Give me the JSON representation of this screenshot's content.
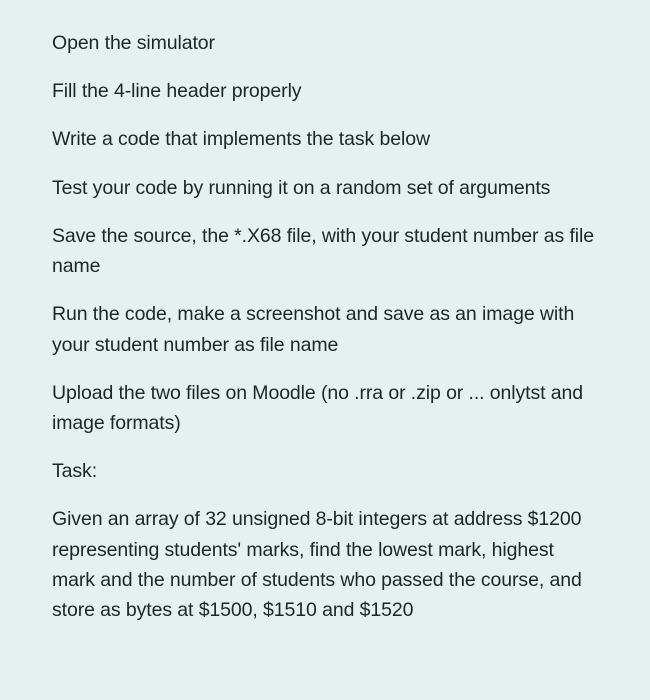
{
  "paragraphs": [
    "Open the simulator",
    "Fill the 4-line header properly",
    "Write a code that implements the task below",
    "Test your code by running it on a random set of arguments",
    "Save the source, the *.X68 file, with your student number as file name",
    "Run the code, make a screenshot and save as an image with your student number as file name",
    "Upload the two files on Moodle (no .rra or .zip or ... onlytst and image formats)",
    "Task:",
    "Given an array of 32 unsigned 8-bit integers at address $1200 representing students' marks, find the lowest mark, highest mark and the number of students who passed the course, and store as bytes at $1500, $1510 and $1520"
  ]
}
